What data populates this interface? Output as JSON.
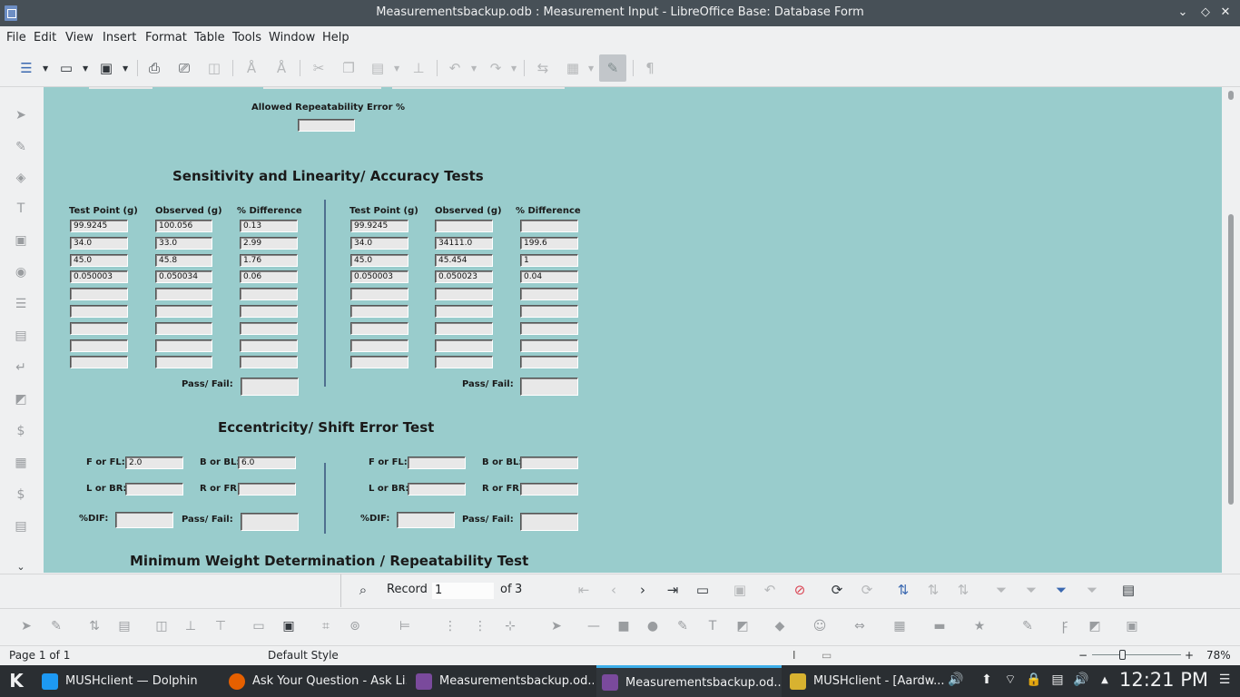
{
  "window": {
    "title": "Measurementsbackup.odb : Measurement Input - LibreOffice Base: Database Form",
    "minimize": "⌄",
    "maximize": "◇",
    "close": "✕"
  },
  "menu": [
    "File",
    "Edit",
    "View",
    "Insert",
    "Format",
    "Table",
    "Tools",
    "Window",
    "Help"
  ],
  "form": {
    "allowed_repeatability_label": "Allowed Repeatability Error %",
    "sensitivity_heading": "Sensitivity and Linearity/ Accuracy Tests",
    "col_test_point": "Test Point (g)",
    "col_observed": "Observed (g)",
    "col_difference": "% Difference",
    "left_table": [
      [
        "99.9245",
        "100.056",
        "0.13"
      ],
      [
        "34.0",
        "33.0",
        "2.99"
      ],
      [
        "45.0",
        "45.8",
        "1.76"
      ],
      [
        "0.050003",
        "0.050034",
        "0.06"
      ],
      [
        "",
        "",
        ""
      ],
      [
        "",
        "",
        ""
      ],
      [
        "",
        "",
        ""
      ],
      [
        "",
        "",
        ""
      ],
      [
        "",
        "",
        ""
      ]
    ],
    "right_table": [
      [
        "99.9245",
        "",
        ""
      ],
      [
        "34.0",
        "34111.0",
        "199.6"
      ],
      [
        "45.0",
        "45.454",
        "1"
      ],
      [
        "0.050003",
        "0.050023",
        "0.04"
      ],
      [
        "",
        "",
        ""
      ],
      [
        "",
        "",
        ""
      ],
      [
        "",
        "",
        ""
      ],
      [
        "",
        "",
        ""
      ],
      [
        "",
        "",
        ""
      ]
    ],
    "pass_fail_label": "Pass/ Fail:",
    "eccentricity_heading": "Eccentricity/ Shift Error Test",
    "f_or_fl_label": "F or FL:",
    "b_or_bl_label": "B or BL:",
    "l_or_br_label": "L or BR:",
    "r_or_fr_label": "R or FR:",
    "dif_label": "%DIF:",
    "left_ecc": {
      "f_or_fl": "2.0",
      "b_or_bl": "6.0",
      "l_or_br": "",
      "r_or_fr": "",
      "dif": "",
      "pass_fail": ""
    },
    "right_ecc": {
      "f_or_fl": "",
      "b_or_bl": "",
      "l_or_br": "",
      "r_or_fr": "",
      "dif": "",
      "pass_fail": ""
    },
    "minimum_weight_heading": "Minimum Weight Determination / Repeatability Test"
  },
  "navigation": {
    "record_label": "Record",
    "record_value": "1",
    "of_label": "of",
    "total": "3"
  },
  "status": {
    "page": "Page 1 of 1",
    "style": "Default Style",
    "zoom": "78%"
  },
  "taskbar": {
    "tasks": [
      {
        "label": "MUSHclient — Dolphin",
        "color": "#1d99f3"
      },
      {
        "label": "Ask Your Question - Ask Li...",
        "color": "#e66000"
      },
      {
        "label": "Measurementsbackup.od...",
        "color": "#7a4a9c"
      },
      {
        "label": "Measurementsbackup.od...",
        "color": "#7a4a9c"
      },
      {
        "label": "MUSHclient - [Aardw...",
        "color": "#d8b230"
      }
    ],
    "clock": "12:21 PM"
  }
}
